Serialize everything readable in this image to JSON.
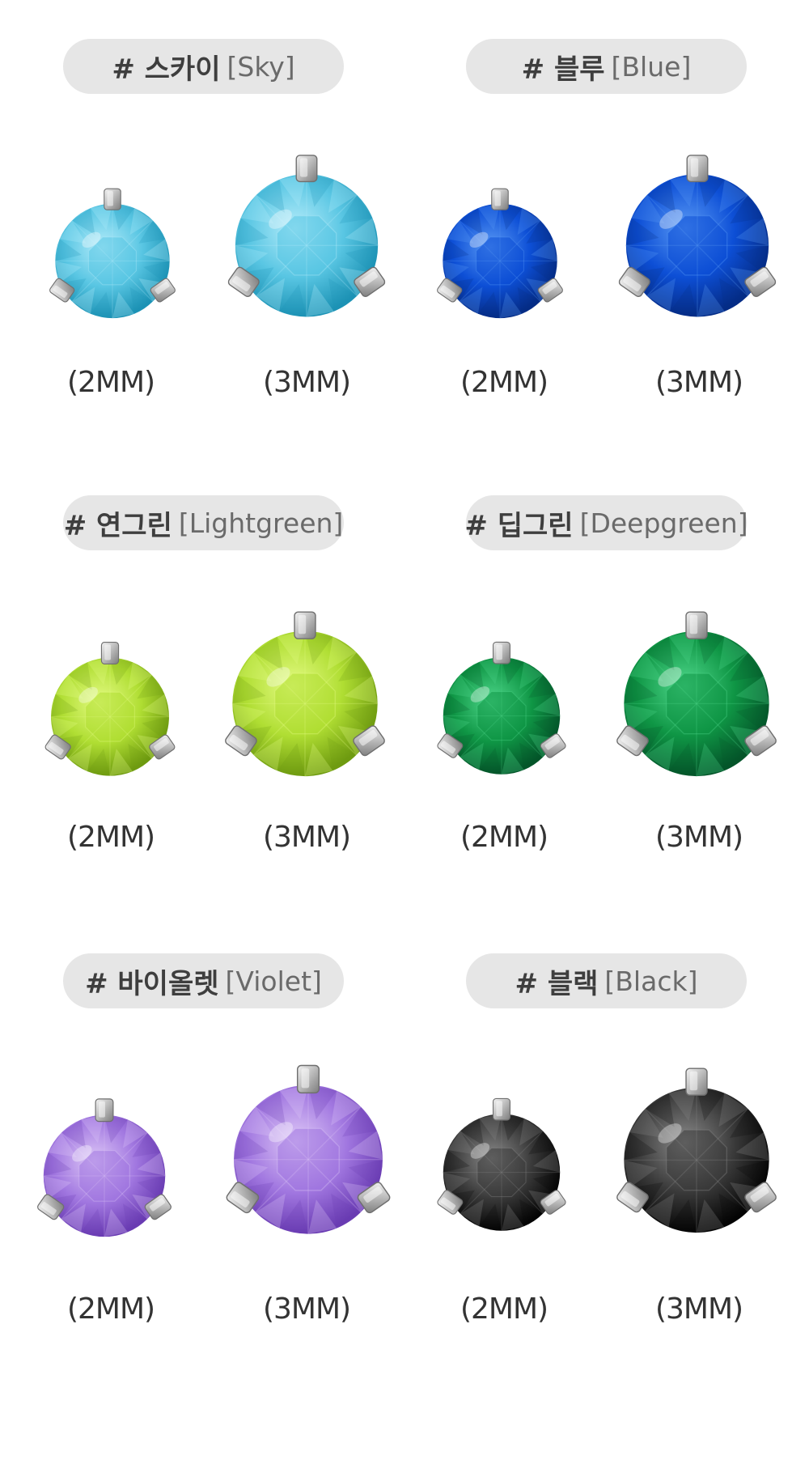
{
  "groups": [
    {
      "tag": "# 스카이",
      "en": "[Sky]",
      "sizes": [
        "(2MM)",
        "(3MM)"
      ],
      "colors": {
        "light": "#b4ecfa",
        "mid": "#59c6e3",
        "dark": "#1d93b5"
      }
    },
    {
      "tag": "# 블루",
      "en": "[Blue]",
      "sizes": [
        "(2MM)",
        "(3MM)"
      ],
      "colors": {
        "light": "#5a9af5",
        "mid": "#0d4fd6",
        "dark": "#052c86"
      }
    },
    {
      "tag": "# 연그린",
      "en": "[Lightgreen]",
      "sizes": [
        "(2MM)",
        "(3MM)"
      ],
      "colors": {
        "light": "#e4fb84",
        "mid": "#b0de33",
        "dark": "#6f9b10"
      }
    },
    {
      "tag": "# 딥그린",
      "en": "[Deepgreen]",
      "sizes": [
        "(2MM)",
        "(3MM)"
      ],
      "colors": {
        "light": "#4fd88c",
        "mid": "#0f9645",
        "dark": "#04552a"
      }
    },
    {
      "tag": "# 바이올렛",
      "en": "[Violet]",
      "sizes": [
        "(2MM)",
        "(3MM)"
      ],
      "colors": {
        "light": "#dec8f7",
        "mid": "#a177e0",
        "dark": "#6a3cb3"
      }
    },
    {
      "tag": "# 블랙",
      "en": "[Black]",
      "sizes": [
        "(2MM)",
        "(3MM)"
      ],
      "colors": {
        "light": "#8a8a8a",
        "mid": "#3a3a3a",
        "dark": "#050505"
      }
    }
  ]
}
